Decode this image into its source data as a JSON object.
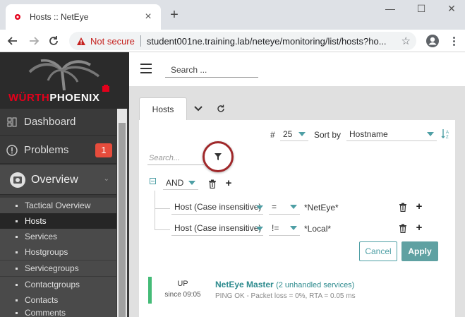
{
  "browser": {
    "tab_title": "Hosts :: NetEye",
    "not_secure": "Not secure",
    "url": "student001ne.training.lab/neteye/monitoring/list/hosts?ho..."
  },
  "logo": {
    "brand_left": "WÜRTH",
    "brand_right": "PHOENIX"
  },
  "sidebar": {
    "items": [
      {
        "label": "Dashboard",
        "icon": "dashboard-icon"
      },
      {
        "label": "Problems",
        "icon": "problems-icon",
        "badge": "1"
      },
      {
        "label": "Overview",
        "icon": "overview-icon"
      }
    ],
    "overview_subitems": [
      "Tactical Overview",
      "Hosts",
      "Services",
      "Hostgroups",
      "Servicegroups",
      "Contactgroups",
      "Contacts",
      "Comments"
    ],
    "active_subitem": "Hosts"
  },
  "topbar": {
    "search_placeholder": "Search ..."
  },
  "tabs": {
    "active_label": "Hosts"
  },
  "controls": {
    "hash": "#",
    "limit": "25",
    "sort_by_label": "Sort by",
    "sort_by_value": "Hostname"
  },
  "filter": {
    "search_placeholder": "Search...",
    "operator": "AND",
    "rules": [
      {
        "column": "Host (Case insensitive)",
        "sign": "=",
        "value": "*NetEye*"
      },
      {
        "column": "Host (Case insensitive)",
        "sign": "!=",
        "value": "*Local*"
      }
    ],
    "cancel_label": "Cancel",
    "apply_label": "Apply"
  },
  "host_list": [
    {
      "state": "UP",
      "since": "since 09:05",
      "name": "NetEye Master",
      "unhandled": "(2 unhandled services)",
      "output": "PING OK - Packet loss = 0%, RTA = 0.05 ms"
    }
  ],
  "colors": {
    "accent": "#4e9fa5",
    "apply": "#5fa1a2",
    "up": "#44bb77",
    "badge": "#e74c3c",
    "highlight_ring": "#a0282a",
    "brand_red": "#e3001b"
  }
}
